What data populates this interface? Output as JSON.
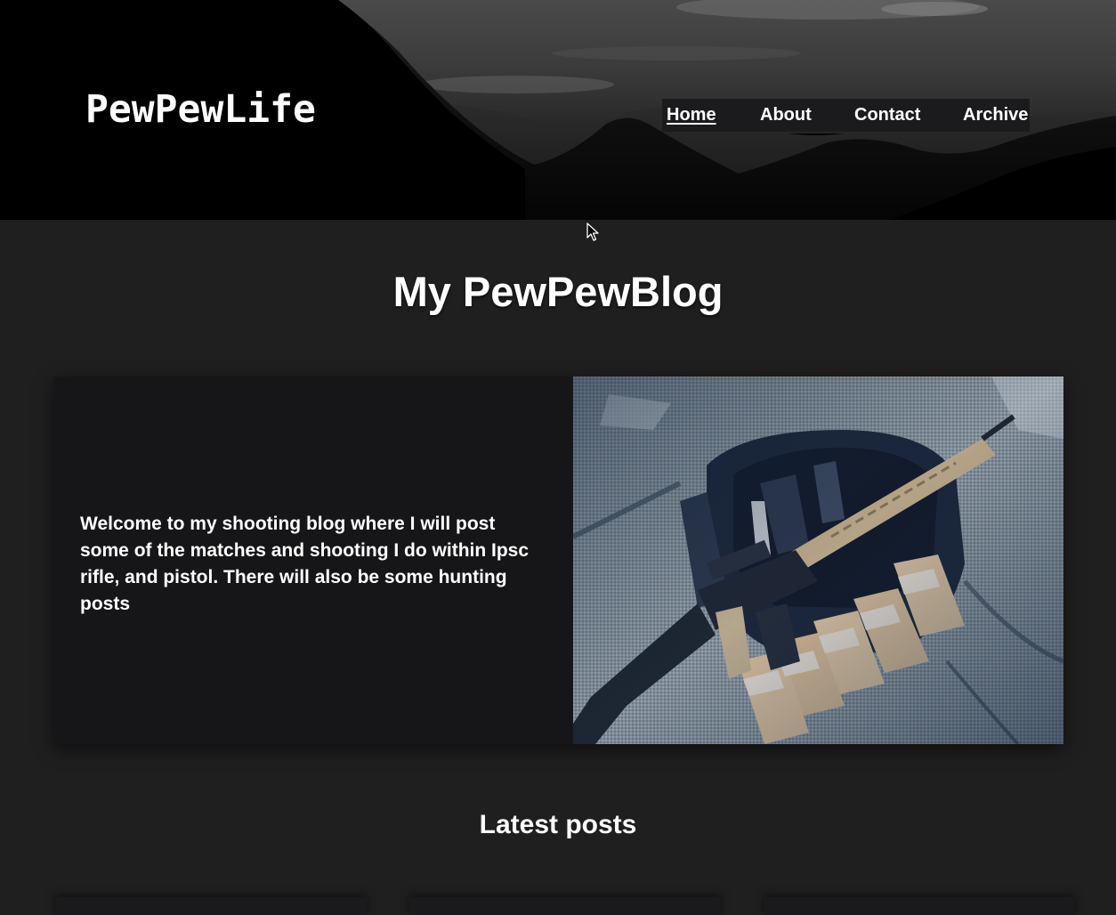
{
  "header": {
    "logo": "PewPewLife",
    "nav": [
      {
        "label": "Home",
        "active": true
      },
      {
        "label": "About",
        "active": false
      },
      {
        "label": "Contact",
        "active": false
      },
      {
        "label": "Archive",
        "active": false
      }
    ]
  },
  "main": {
    "title": "My PewPewBlog",
    "intro": {
      "text": "Welcome to my shooting blog where I will post some of the matches and shooting I do within Ipsc rifle, and pistol. There will also be some hunting posts"
    },
    "latest_title": "Latest posts"
  },
  "colors": {
    "header_bg": "#000000",
    "page_bg": "#1f1f1f",
    "card_bg": "#161618",
    "nav_bg": "#1b1b1e",
    "text": "#ffffff"
  },
  "icons": {
    "cursor": "mouse-pointer-icon"
  }
}
